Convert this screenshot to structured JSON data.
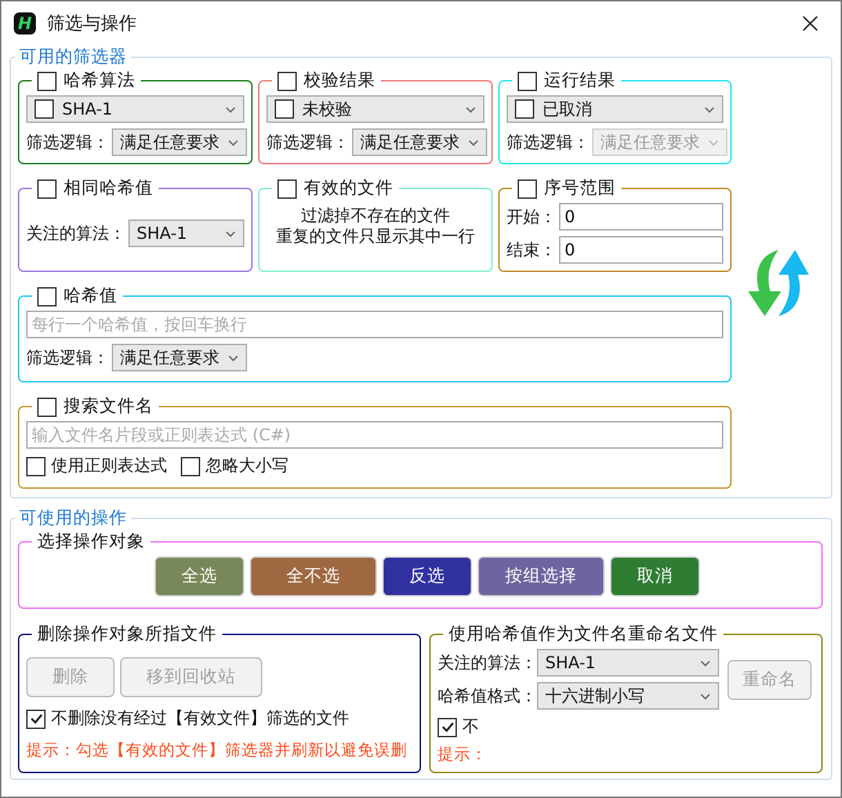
{
  "window": {
    "title": "筛选与操作",
    "logo": "H"
  },
  "filters": {
    "title": "可用的筛选器",
    "groups": [
      {
        "kind": "select_logic",
        "label": "哈希算法",
        "checked": false,
        "color": "#1a7f1a",
        "option": {
          "text": "SHA-1",
          "checked": false
        },
        "logic_label": "筛选逻辑：",
        "logic": "满足任意要求",
        "logic_disabled": false
      },
      {
        "kind": "select_logic",
        "label": "校验结果",
        "checked": false,
        "color": "#f07878",
        "option": {
          "text": "未校验",
          "checked": false
        },
        "logic_label": "筛选逻辑：",
        "logic": "满足任意要求",
        "logic_disabled": false
      },
      {
        "kind": "select_logic",
        "label": "运行结果",
        "checked": false,
        "color": "#22e8f0",
        "option": {
          "text": "已取消",
          "checked": false
        },
        "logic_label": "筛选逻辑：",
        "logic": "满足任意要求",
        "logic_disabled": true
      },
      {
        "kind": "algorithm",
        "label": "相同哈希值",
        "checked": false,
        "color": "#9a78e0",
        "field_label": "关注的算法：",
        "value": "SHA-1"
      },
      {
        "kind": "note",
        "label": "有效的文件",
        "checked": false,
        "color": "#80f0d0",
        "lines": [
          "过滤掉不存在的文件",
          "重复的文件只显示其中一行"
        ]
      },
      {
        "kind": "range",
        "label": "序号范围",
        "checked": false,
        "color": "#c08a20",
        "start_label": "开始：",
        "start": "0",
        "end_label": "结束：",
        "end": "0"
      },
      {
        "kind": "hash_list",
        "label": "哈希值",
        "checked": false,
        "color": "#20c8f0",
        "placeholder": "每行一个哈希值，按回车换行",
        "logic_label": "筛选逻辑：",
        "logic": "满足任意要求"
      },
      {
        "kind": "filename",
        "label": "搜索文件名",
        "checked": false,
        "color": "#c8962a",
        "placeholder": "输入文件名片段或正则表达式 (C#)",
        "options": [
          {
            "label": "使用正则表达式",
            "checked": false
          },
          {
            "label": "忽略大小写",
            "checked": false
          }
        ]
      }
    ]
  },
  "actions": {
    "title": "可使用的操作",
    "select": {
      "title": "选择操作对象",
      "buttons": [
        {
          "label": "全选",
          "color": "#788858"
        },
        {
          "label": "全不选",
          "color": "#a06840"
        },
        {
          "label": "反选",
          "color": "#3030a0"
        },
        {
          "label": "按组选择",
          "color": "#7064a0"
        },
        {
          "label": "取消",
          "color": "#2e7d32"
        }
      ]
    },
    "delete": {
      "title": "删除操作对象所指文件",
      "buttons": [
        {
          "label": "删除",
          "disabled": true
        },
        {
          "label": "移到回收站",
          "disabled": true
        }
      ],
      "option": {
        "label": "不删除没有经过【有效文件】筛选的文件",
        "checked": true
      },
      "hint": "提示：勾选【有效的文件】筛选器并刷新以避免误删"
    },
    "rename": {
      "title": "使用哈希值作为文件名重命名文件",
      "algorithm_label": "关注的算法：",
      "algorithm": "SHA-1",
      "format_label": "哈希值格式：",
      "format": "十六进制小写",
      "button": {
        "label": "重命名",
        "disabled": true
      },
      "option": {
        "label": "不",
        "checked": true
      },
      "hint": "提示："
    }
  }
}
